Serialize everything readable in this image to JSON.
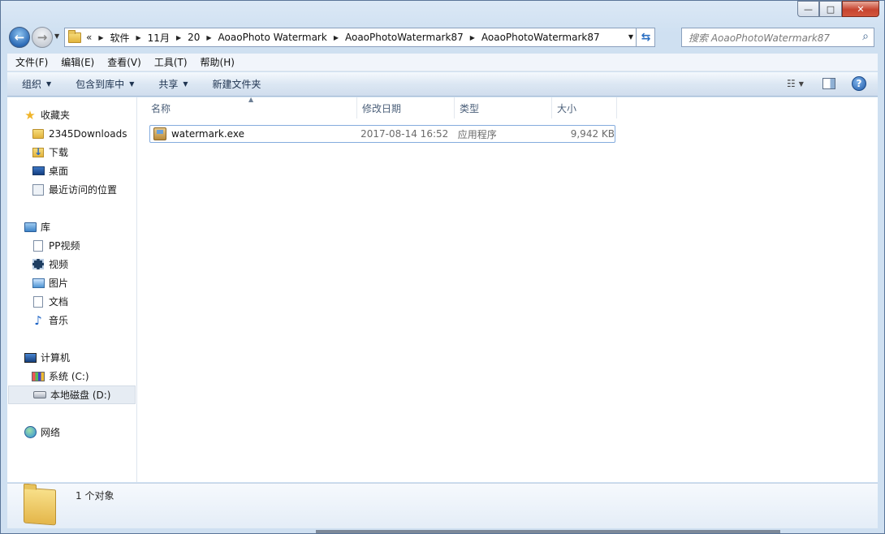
{
  "window": {
    "caption": {
      "minimize": "—",
      "maximize": "□",
      "close": "✕"
    }
  },
  "navigation": {
    "back_glyph": "←",
    "forward_glyph": "→",
    "chevrons": "«",
    "breadcrumbs": [
      "软件",
      "11月",
      "20",
      "AoaoPhoto Watermark",
      "AoaoPhotoWatermark87",
      "AoaoPhotoWatermark87"
    ],
    "search_placeholder": "搜索 AoaoPhotoWatermark87"
  },
  "menubar": {
    "items": [
      "文件(F)",
      "编辑(E)",
      "查看(V)",
      "工具(T)",
      "帮助(H)"
    ]
  },
  "commandbar": {
    "organize": "组织",
    "include_library": "包含到库中",
    "share": "共享",
    "new_folder": "新建文件夹",
    "help": "?"
  },
  "sidebar": {
    "favorites": {
      "label": "收藏夹",
      "items": [
        "2345Downloads",
        "下载",
        "桌面",
        "最近访问的位置"
      ]
    },
    "libraries": {
      "label": "库",
      "items": [
        "PP视频",
        "视频",
        "图片",
        "文档",
        "音乐"
      ]
    },
    "computer": {
      "label": "计算机",
      "items": [
        "系统 (C:)",
        "本地磁盘 (D:)"
      ]
    },
    "network": {
      "label": "网络"
    }
  },
  "file_list": {
    "columns": [
      "名称",
      "修改日期",
      "类型",
      "大小"
    ],
    "rows": [
      {
        "name": "watermark.exe",
        "date": "2017-08-14 16:52",
        "type": "应用程序",
        "size": "9,942 KB"
      }
    ]
  },
  "details": {
    "count": "1 个对象"
  },
  "icons": {
    "star": "★",
    "note": "♪",
    "search": "⌕",
    "refresh": "⇆"
  }
}
